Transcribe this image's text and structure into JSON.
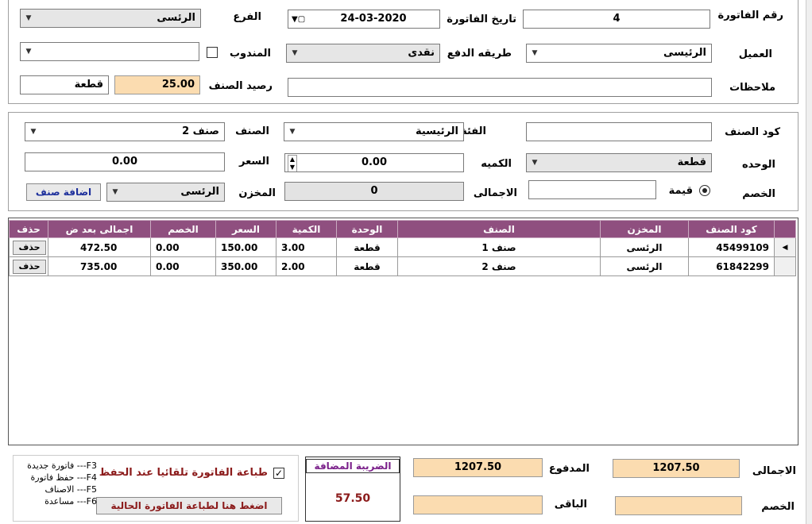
{
  "header": {
    "invoice_no_label": "رقم الفاتورة",
    "invoice_no": "4",
    "invoice_date_label": "تاريخ الفاتورة",
    "invoice_date": "24-03-2020",
    "branch_label": "الفرع",
    "branch": "الرئسى",
    "customer_label": "العميل",
    "customer": "الرئيسى",
    "payment_method_label": "طريقه الدفع",
    "payment_method": "نقدى",
    "rep_label": "المندوب",
    "rep": "",
    "notes_label": "ملاحظات",
    "notes": "",
    "item_balance_label": "رصيد الصنف",
    "item_balance": "25.00",
    "item_balance_unit": "قطعة"
  },
  "item_entry": {
    "item_code_label": "كود الصنف",
    "item_code": "",
    "category_label": "الفئة",
    "category": "الرئيسية",
    "item_label": "الصنف",
    "item": "صنف 2",
    "unit_label": "الوحده",
    "unit": "قطعة",
    "quantity_label": "الكميه",
    "quantity": "0.00",
    "price_label": "السعر",
    "price": "0.00",
    "discount_label": "الخصم",
    "discount_type": "قيمة",
    "discount_value": "",
    "total_label": "الاجمالى",
    "total": "0",
    "store_label": "المخزن",
    "store": "الرئسى",
    "add_button": "اضافة صنف"
  },
  "grid": {
    "columns": [
      "كود الصنف",
      "المخزن",
      "الصنف",
      "الوحدة",
      "الكمية",
      "السعر",
      "الخصم",
      "اجمالى بعد ض",
      "حذف"
    ],
    "rows": [
      {
        "code": "45499109",
        "store": "الرئسى",
        "item": "صنف 1",
        "unit": "قطعة",
        "qty": "3.00",
        "price": "150.00",
        "discount": "0.00",
        "total": "472.50",
        "delete": "حذف"
      },
      {
        "code": "61842299",
        "store": "الرئسى",
        "item": "صنف 2",
        "unit": "قطعة",
        "qty": "2.00",
        "price": "350.00",
        "discount": "0.00",
        "total": "735.00",
        "delete": "حذف"
      }
    ]
  },
  "footer": {
    "total_label": "الاجمالى",
    "total": "1207.50",
    "paid_label": "المدفوع",
    "paid": "1207.50",
    "discount_label": "الخصم",
    "discount": "",
    "remaining_label": "الباقى",
    "remaining": "",
    "vat_label": "الضريبة المضافة",
    "vat": "57.50",
    "auto_print_label": "طباعة الفاتورة تلقائيا عند الحفظ",
    "print_button": "اضغط هنا لطباعة الفاتورة الحالية",
    "shortcuts": [
      "فاتورة جديدة ---F3",
      "حفظ فاتورة ---F4",
      "الاصناف ---F5",
      "مساعدة ---F6"
    ]
  },
  "colors": {
    "grid_header": "#8f4f7f",
    "peach": "#fbdcb0",
    "dark_red_text": "#8b1a1a",
    "purple_text": "#7a1f8a"
  }
}
